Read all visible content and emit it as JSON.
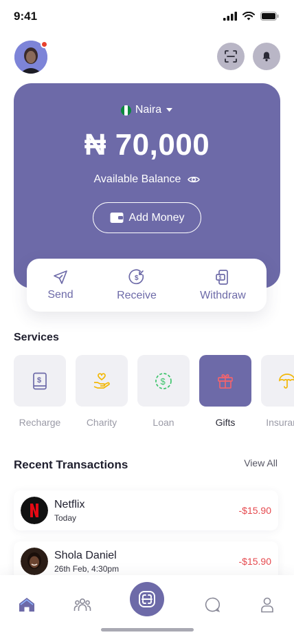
{
  "status_bar": {
    "time": "9:41"
  },
  "header": {
    "avatar_icon": "user-avatar",
    "scan_icon": "scan-icon",
    "bell_icon": "bell-icon"
  },
  "balance_card": {
    "currency": "Naira",
    "amount": "₦ 70,000",
    "label": "Available Balance",
    "add_money_label": "Add Money"
  },
  "actions": [
    {
      "label": "Send",
      "icon": "send-icon"
    },
    {
      "label": "Receive",
      "icon": "receive-icon"
    },
    {
      "label": "Withdraw",
      "icon": "withdraw-icon"
    }
  ],
  "services": {
    "title": "Services",
    "items": [
      {
        "label": "Recharge",
        "icon": "recharge-icon",
        "active": false
      },
      {
        "label": "Charity",
        "icon": "charity-icon",
        "active": false
      },
      {
        "label": "Loan",
        "icon": "loan-icon",
        "active": false
      },
      {
        "label": "Gifts",
        "icon": "gift-icon",
        "active": true
      },
      {
        "label": "Insurance",
        "icon": "umbrella-icon",
        "active": false
      }
    ]
  },
  "transactions": {
    "title": "Recent Transactions",
    "view_all": "View All",
    "items": [
      {
        "name": "Netflix",
        "date": "Today",
        "amount": "-$15.90"
      },
      {
        "name": "Shola Daniel",
        "date": "26th Feb, 4:30pm",
        "amount": "-$15.90"
      }
    ]
  },
  "colors": {
    "primary": "#6d6aa8",
    "negative": "#e5484d",
    "notification": "#e8412c"
  }
}
